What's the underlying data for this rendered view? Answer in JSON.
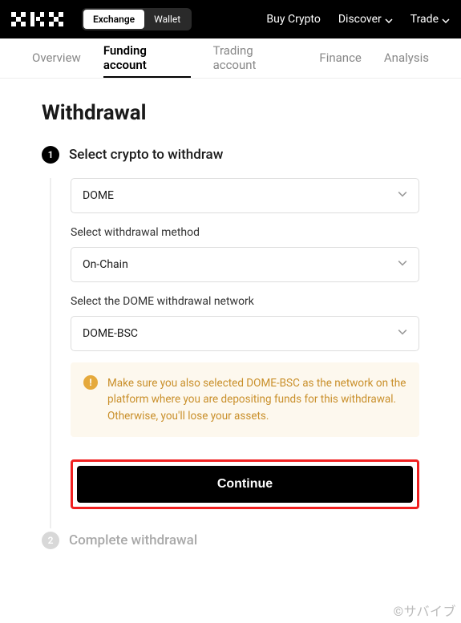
{
  "topbar": {
    "toggle": {
      "exchange": "Exchange",
      "wallet": "Wallet"
    },
    "nav": {
      "buy": "Buy Crypto",
      "discover": "Discover",
      "trade": "Trade"
    }
  },
  "subtabs": {
    "overview": "Overview",
    "funding": "Funding account",
    "trading": "Trading account",
    "finance": "Finance",
    "analysis": "Analysis"
  },
  "page": {
    "title": "Withdrawal"
  },
  "step1": {
    "number": "1",
    "title": "Select crypto to withdraw",
    "crypto_value": "DOME",
    "method_label": "Select withdrawal method",
    "method_value": "On-Chain",
    "network_label": "Select the DOME withdrawal network",
    "network_value": "DOME-BSC",
    "warning": "Make sure you also selected DOME-BSC as the network on the platform where you are depositing funds for this withdrawal. Otherwise, you'll lose your assets.",
    "warning_mark": "!",
    "continue": "Continue"
  },
  "step2": {
    "number": "2",
    "title": "Complete withdrawal"
  },
  "watermark": "©サバイブ"
}
